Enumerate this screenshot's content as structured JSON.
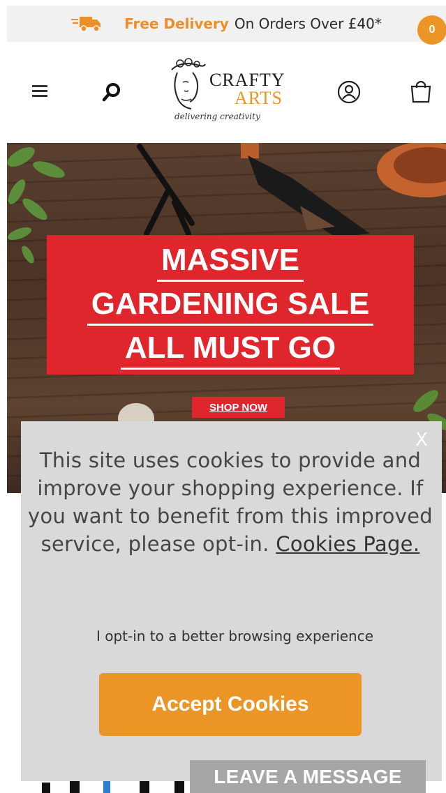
{
  "promo": {
    "icon": "delivery-truck-icon",
    "highlight": "Free Delivery",
    "text": "On Orders Over £40*",
    "accent_color": "#eb8e2b"
  },
  "header": {
    "logo": {
      "word1": "CRAFTY",
      "word2": "ARTS",
      "tagline": "delivering creativity"
    },
    "cart_count": "0",
    "icons": [
      "menu-icon",
      "search-icon",
      "account-icon",
      "cart-icon"
    ]
  },
  "hero": {
    "lines": [
      "MASSIVE",
      "GARDENING SALE",
      "ALL MUST GO"
    ],
    "cta": "SHOP NOW",
    "banner_color": "#e0262d"
  },
  "cookie": {
    "close": "X",
    "message": "This site uses cookies to provide and improve your shopping experience. If you want to benefit from this improved service, please opt-in.",
    "link": "Cookies Page.",
    "optin": "I opt-in to a better browsing experience",
    "accept": "Accept Cookies",
    "button_color": "#eb9526"
  },
  "chat": {
    "label": "LEAVE A MESSAGE"
  }
}
